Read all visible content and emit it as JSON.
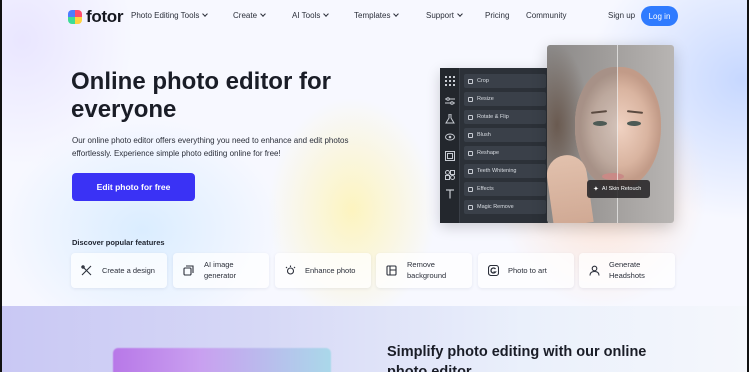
{
  "brand": {
    "name": "fotor"
  },
  "nav": {
    "items": [
      {
        "label": "Photo Editing Tools",
        "dropdown": true
      },
      {
        "label": "Create",
        "dropdown": true
      },
      {
        "label": "AI Tools",
        "dropdown": true
      },
      {
        "label": "Templates",
        "dropdown": true
      },
      {
        "label": "Support",
        "dropdown": true
      },
      {
        "label": "Pricing",
        "dropdown": false
      },
      {
        "label": "Community",
        "dropdown": false
      }
    ],
    "signup_label": "Sign up",
    "login_label": "Log in"
  },
  "hero": {
    "title": "Online photo editor for everyone",
    "description": "Our online photo editor offers everything you need to enhance and edit photos effortlessly. Experience simple photo editing online for free!",
    "cta_label": "Edit photo for free"
  },
  "editor_preview": {
    "tools": [
      "Crop",
      "Resize",
      "Rotate & Flip",
      "Blush",
      "Reshape",
      "Teeth Whitening",
      "Effects",
      "Magic Remove"
    ],
    "rail_icons": [
      "grid-icon",
      "sliders-icon",
      "flask-icon",
      "eye-icon",
      "frame-icon",
      "elements-icon",
      "text-icon"
    ],
    "badge_label": "AI Skin Retouch"
  },
  "features": {
    "title": "Discover popular features",
    "items": [
      {
        "label": "Create a design",
        "icon": "design-tools-icon"
      },
      {
        "label": "AI image generator",
        "icon": "ai-image-icon"
      },
      {
        "label": "Enhance photo",
        "icon": "enhance-icon"
      },
      {
        "label": "Remove background",
        "icon": "remove-background-icon"
      },
      {
        "label": "Photo to art",
        "icon": "photo-to-art-icon"
      },
      {
        "label": "Generate Headshots",
        "icon": "headshot-icon"
      }
    ]
  },
  "section2": {
    "title": "Simplify photo editing with our online photo editor"
  },
  "colors": {
    "primary_button": "#3a32f5",
    "login_button": "#2f7bff",
    "editor_panel": "#2c3138"
  }
}
